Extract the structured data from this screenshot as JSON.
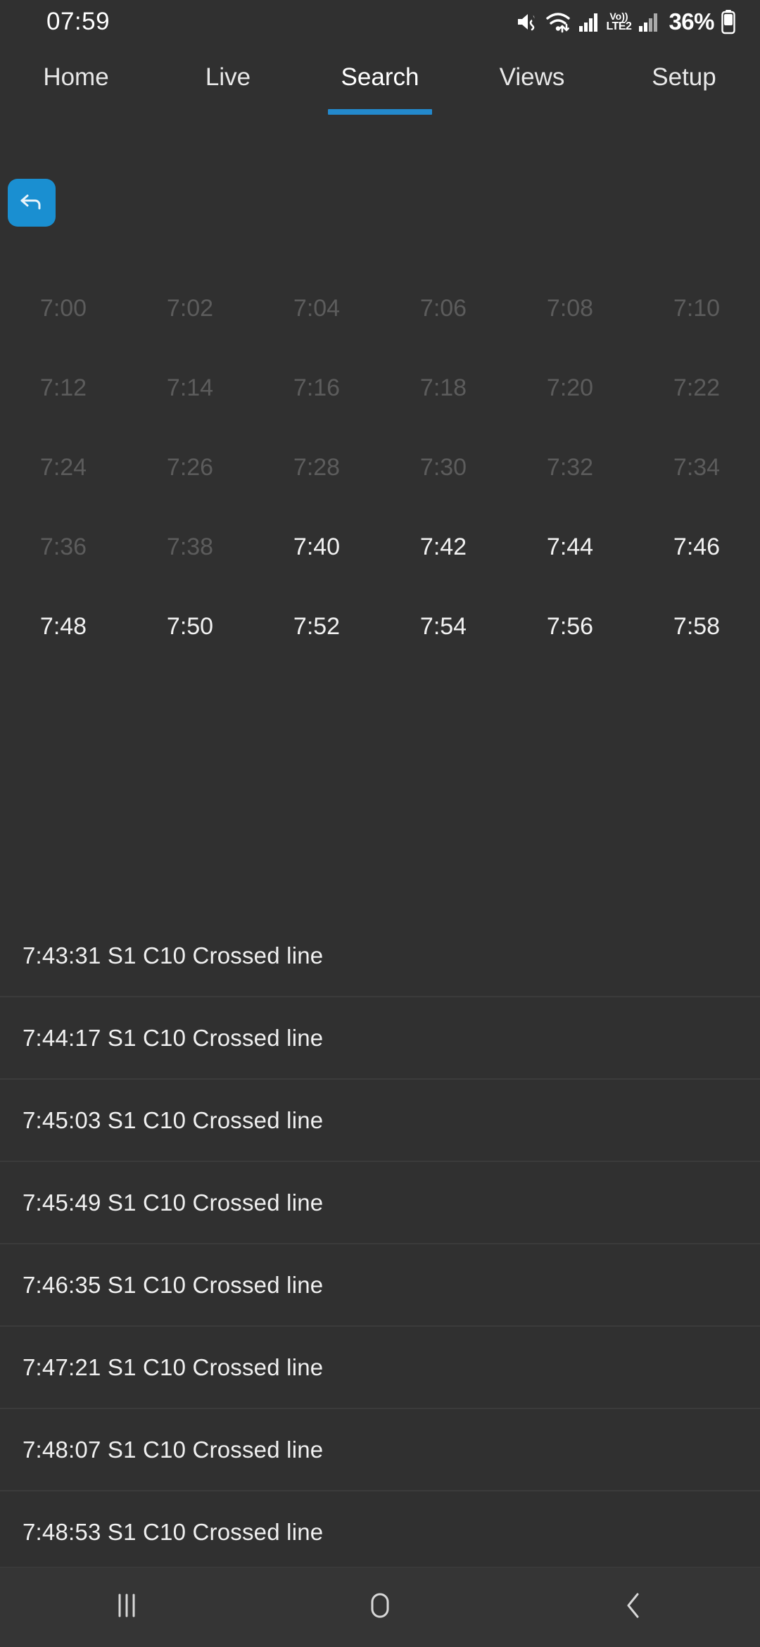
{
  "status_bar": {
    "clock": "07:59",
    "battery_percent": "36%",
    "volte_top": "Vo))",
    "volte_bottom": "LTE2",
    "icons": [
      "mute-icon",
      "wifi-icon",
      "signal-icon",
      "volte-icon",
      "signal2-icon",
      "battery-icon"
    ]
  },
  "tabs": [
    {
      "label": "Home",
      "active": false
    },
    {
      "label": "Live",
      "active": false
    },
    {
      "label": "Search",
      "active": true
    },
    {
      "label": "Views",
      "active": false
    },
    {
      "label": "Setup",
      "active": false
    }
  ],
  "accent_color": "#2389cc",
  "back_button": {
    "icon": "undo-arrow-icon"
  },
  "time_grid": {
    "columns": 6,
    "cells": [
      {
        "label": "7:00",
        "state": "dim"
      },
      {
        "label": "7:02",
        "state": "dim"
      },
      {
        "label": "7:04",
        "state": "dim"
      },
      {
        "label": "7:06",
        "state": "dim"
      },
      {
        "label": "7:08",
        "state": "dim"
      },
      {
        "label": "7:10",
        "state": "dim"
      },
      {
        "label": "7:12",
        "state": "dim"
      },
      {
        "label": "7:14",
        "state": "dim"
      },
      {
        "label": "7:16",
        "state": "dim"
      },
      {
        "label": "7:18",
        "state": "dim"
      },
      {
        "label": "7:20",
        "state": "dim"
      },
      {
        "label": "7:22",
        "state": "dim"
      },
      {
        "label": "7:24",
        "state": "dim"
      },
      {
        "label": "7:26",
        "state": "dim"
      },
      {
        "label": "7:28",
        "state": "dim"
      },
      {
        "label": "7:30",
        "state": "dim"
      },
      {
        "label": "7:32",
        "state": "dim"
      },
      {
        "label": "7:34",
        "state": "dim"
      },
      {
        "label": "7:36",
        "state": "dim"
      },
      {
        "label": "7:38",
        "state": "dim"
      },
      {
        "label": "7:40",
        "state": "bright"
      },
      {
        "label": "7:42",
        "state": "bright"
      },
      {
        "label": "7:44",
        "state": "bright"
      },
      {
        "label": "7:46",
        "state": "bright"
      },
      {
        "label": "7:48",
        "state": "bright"
      },
      {
        "label": "7:50",
        "state": "bright"
      },
      {
        "label": "7:52",
        "state": "bright"
      },
      {
        "label": "7:54",
        "state": "bright"
      },
      {
        "label": "7:56",
        "state": "bright"
      },
      {
        "label": "7:58",
        "state": "bright"
      }
    ]
  },
  "events": [
    {
      "text": "7:43:31 S1 C10 Crossed line"
    },
    {
      "text": "7:44:17 S1 C10 Crossed line"
    },
    {
      "text": "7:45:03 S1 C10 Crossed line"
    },
    {
      "text": "7:45:49 S1 C10 Crossed line"
    },
    {
      "text": "7:46:35 S1 C10 Crossed line"
    },
    {
      "text": "7:47:21 S1 C10 Crossed line"
    },
    {
      "text": "7:48:07 S1 C10 Crossed line"
    },
    {
      "text": "7:48:53 S1 C10 Crossed line"
    }
  ],
  "nav_bar": {
    "recents": "recents-icon",
    "home": "home-icon",
    "back": "back-chevron-icon"
  }
}
